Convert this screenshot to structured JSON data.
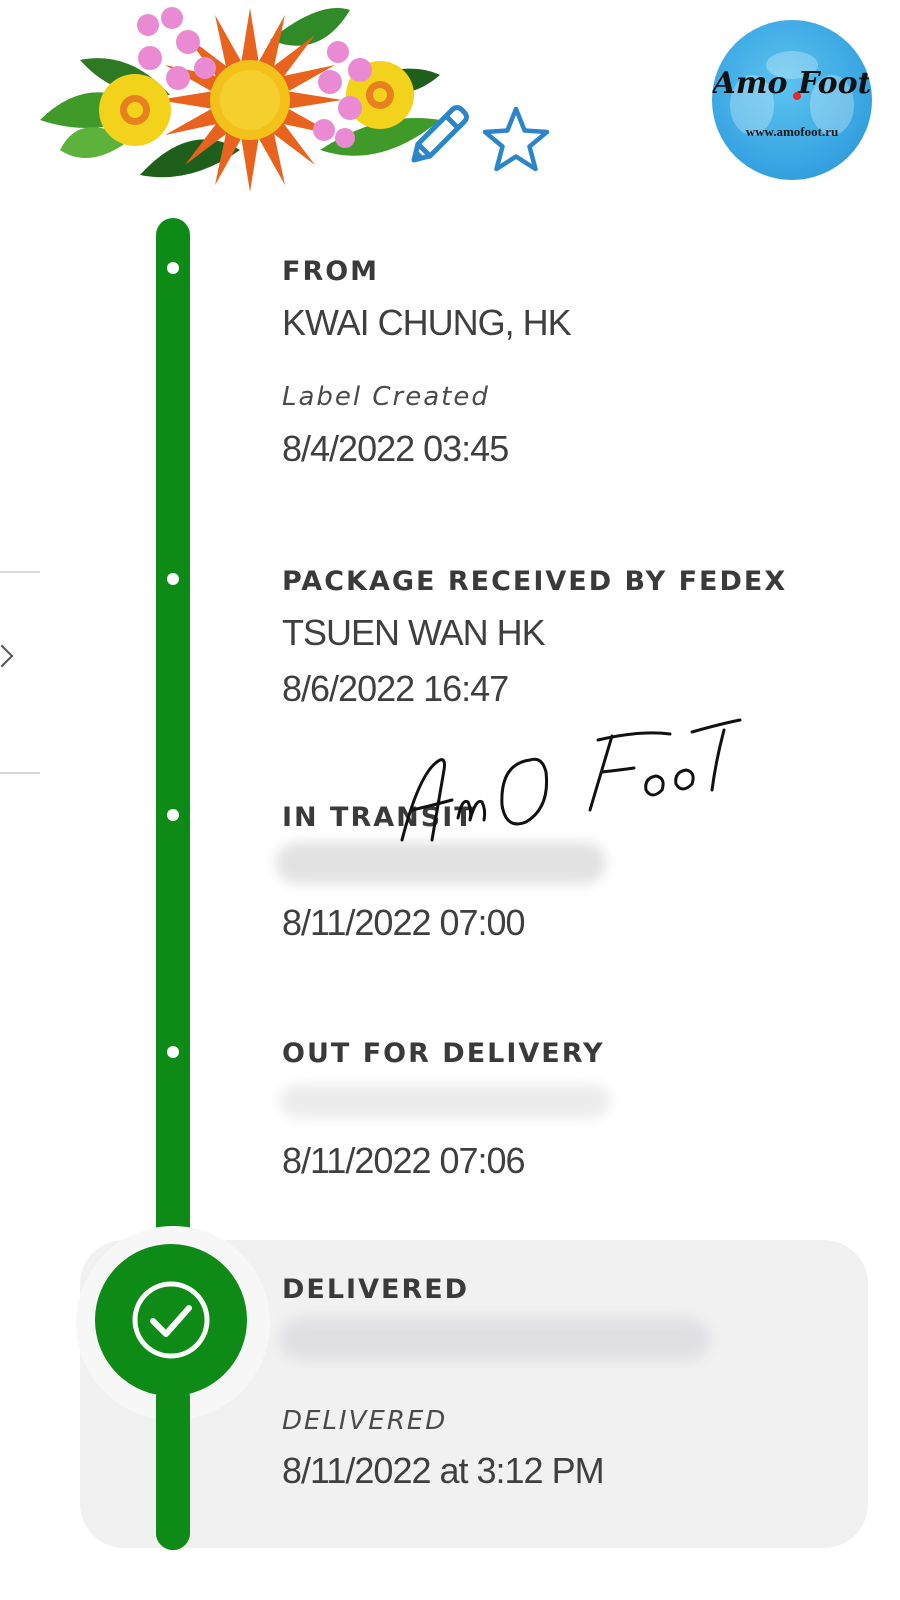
{
  "header": {
    "title_partial": "",
    "edit_icon": "pencil-icon",
    "favorite_icon": "star-outline-icon"
  },
  "logo": {
    "name": "Amo Foot",
    "url": "www.amofoot.ru"
  },
  "watermark": {
    "signature": "AmO Foot"
  },
  "timeline": {
    "from": {
      "label": "FROM",
      "location": "KWAI CHUNG, HK",
      "status": "Label Created",
      "datetime": "8/4/2022 03:45"
    },
    "events": [
      {
        "label": "PACKAGE RECEIVED BY FEDEX",
        "location": "TSUEN WAN HK",
        "datetime": "8/6/2022 16:47"
      },
      {
        "label": "IN TRANSIT",
        "location": "",
        "datetime": "8/11/2022 07:00"
      },
      {
        "label": "OUT FOR DELIVERY",
        "location": "",
        "datetime": "8/11/2022 07:06"
      }
    ],
    "delivered": {
      "label": "DELIVERED",
      "location": "",
      "status": "DELIVERED",
      "datetime": "8/11/2022 at 3:12 PM"
    }
  },
  "colors": {
    "timeline_green": "#0e8a16",
    "card_bg": "#f1f1f1",
    "icon_blue": "#2a86c8"
  }
}
